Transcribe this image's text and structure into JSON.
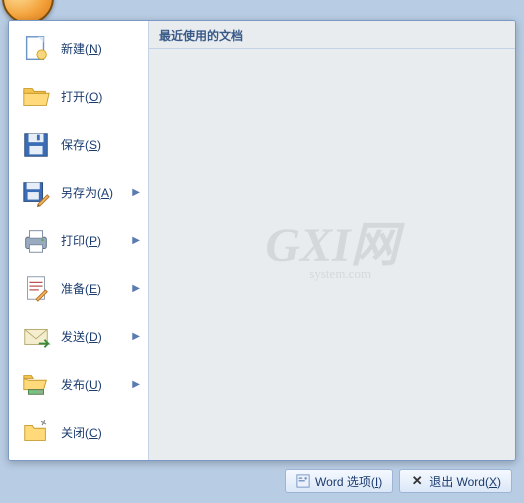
{
  "menu": {
    "items": [
      {
        "id": "new",
        "label": "新建",
        "key": "N",
        "arrow": false
      },
      {
        "id": "open",
        "label": "打开",
        "key": "O",
        "arrow": false
      },
      {
        "id": "save",
        "label": "保存",
        "key": "S",
        "arrow": false
      },
      {
        "id": "saveas",
        "label": "另存为",
        "key": "A",
        "arrow": true
      },
      {
        "id": "print",
        "label": "打印",
        "key": "P",
        "arrow": true
      },
      {
        "id": "prepare",
        "label": "准备",
        "key": "E",
        "arrow": true
      },
      {
        "id": "send",
        "label": "发送",
        "key": "D",
        "arrow": true
      },
      {
        "id": "publish",
        "label": "发布",
        "key": "U",
        "arrow": true
      },
      {
        "id": "close",
        "label": "关闭",
        "key": "C",
        "arrow": false
      }
    ]
  },
  "recent": {
    "header": "最近使用的文档"
  },
  "watermark": {
    "line1": "GXI网",
    "line2": "system.com"
  },
  "footer": {
    "options": {
      "label": "Word 选项",
      "key": "I"
    },
    "exit": {
      "label": "退出 Word",
      "key": "X"
    }
  }
}
